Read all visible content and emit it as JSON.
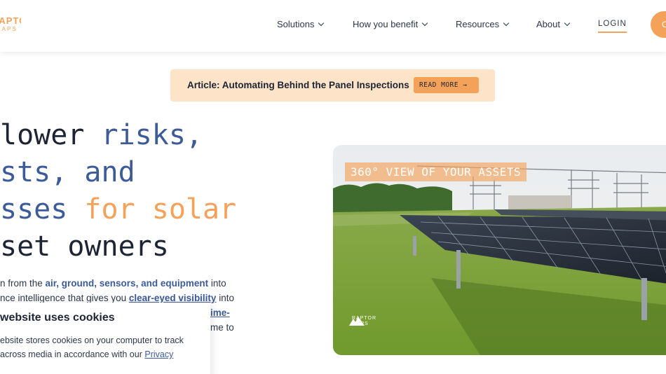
{
  "brand": {
    "logo_main": "RAPTOR",
    "logo_sub": "MAPS"
  },
  "nav": {
    "items": [
      {
        "label": "Solutions"
      },
      {
        "label": "How you benefit"
      },
      {
        "label": "Resources"
      },
      {
        "label": "About"
      }
    ],
    "login": "LOGIN",
    "cta": "C"
  },
  "banner": {
    "text": "Article: Automating Behind the Panel Inspections",
    "button": "READ MORE →"
  },
  "hero": {
    "line1": [
      "lower",
      " risks,"
    ],
    "line2": [
      "sts,",
      " and"
    ],
    "line3": [
      "sses",
      " for solar"
    ],
    "line4": "set owners"
  },
  "paragraph": {
    "p1a": "n from the ",
    "p1b": "air, ground, sensors, and equipment",
    "p1c": " into",
    "p2a": "nce intelligence that gives you ",
    "p2b": "clear-eyed visibility",
    "p2c": " into",
    "p3": "ime-",
    "p4": "me to"
  },
  "cookie": {
    "title": "website uses cookies",
    "line1": "ebsite stores cookies on your computer to track",
    "line2": "across media in accordance with our ",
    "link": "Privacy "
  },
  "video": {
    "label": "360° VIEW OF YOUR ASSETS",
    "logo_text_1": "RAPTOR",
    "logo_text_2": "MAPS"
  },
  "colors": {
    "accent_orange": "#f4a259",
    "brand_blue": "#3d5a99",
    "banner_bg": "#fde3c8"
  }
}
